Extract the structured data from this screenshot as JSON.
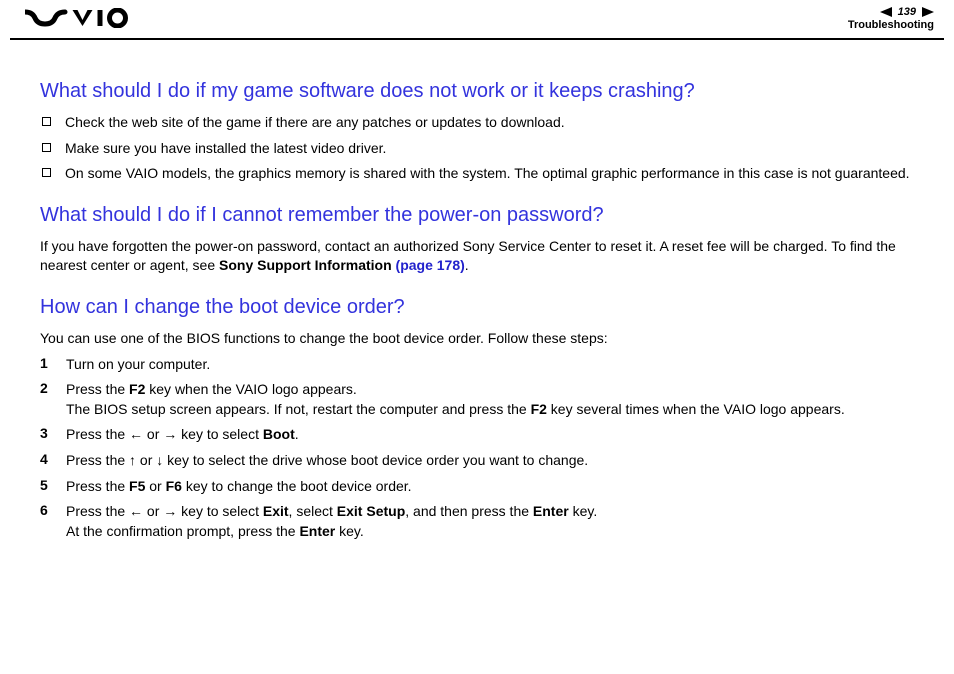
{
  "header": {
    "page_number": "139",
    "section": "Troubleshooting"
  },
  "sections": {
    "s1": {
      "title": "What should I do if my game software does not work or it keeps crashing?",
      "bullets": [
        "Check the web site of the game if there are any patches or updates to download.",
        "Make sure you have installed the latest video driver.",
        "On some VAIO models, the graphics memory is shared with the system. The optimal graphic performance in this case is not guaranteed."
      ]
    },
    "s2": {
      "title": "What should I do if I cannot remember the power-on password?",
      "para_a": "If you have forgotten the power-on password, contact an authorized Sony Service Center to reset it. A reset fee will be charged. To find the nearest center or agent, see ",
      "link_bold": "Sony Support Information ",
      "link_page": "(page 178)",
      "para_tail": "."
    },
    "s3": {
      "title": "How can I change the boot device order?",
      "intro": "You can use one of the BIOS functions to change the boot device order. Follow these steps:",
      "steps": {
        "n1": "1",
        "t1": "Turn on your computer.",
        "n2": "2",
        "t2a": "Press the ",
        "t2b": "F2",
        "t2c": " key when the VAIO logo appears.",
        "t2d": "The BIOS setup screen appears. If not, restart the computer and press the ",
        "t2e": "F2",
        "t2f": " key several times when the VAIO logo appears.",
        "n3": "3",
        "t3a": "Press the ",
        "t3arrowL": "←",
        "t3or": " or ",
        "t3arrowR": "→",
        "t3b": " key to select ",
        "t3boot": "Boot",
        "t3c": ".",
        "n4": "4",
        "t4a": "Press the ",
        "t4arrowU": "↑",
        "t4or": " or ",
        "t4arrowD": "↓",
        "t4b": " key to select the drive whose boot device order you want to change.",
        "n5": "5",
        "t5a": "Press the ",
        "t5f5": "F5",
        "t5or": " or ",
        "t5f6": "F6",
        "t5b": " key to change the boot device order.",
        "n6": "6",
        "t6a": "Press the ",
        "t6arrowL": "←",
        "t6or": " or ",
        "t6arrowR": "→",
        "t6b": " key to select ",
        "t6exit": "Exit",
        "t6c": ", select ",
        "t6exitsetup": "Exit Setup",
        "t6d": ", and then press the ",
        "t6enter": "Enter",
        "t6e": " key.",
        "t6f": "At the confirmation prompt, press the ",
        "t6enter2": "Enter",
        "t6g": " key."
      }
    }
  }
}
